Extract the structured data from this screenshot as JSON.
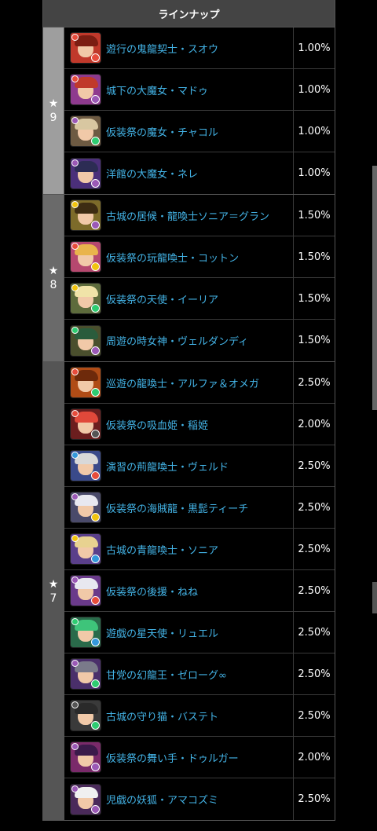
{
  "header": {
    "title": "ラインナップ"
  },
  "groups": [
    {
      "star": "★",
      "rank": "9",
      "items": [
        {
          "name": "遊行の鬼龍契士・スオウ",
          "rate": "1.00%",
          "bg": "#c0392b",
          "hair": "#7b1d12",
          "orb": "#e74c3c",
          "orb2": "#e74c3c"
        },
        {
          "name": "城下の大魔女・マドゥ",
          "rate": "1.00%",
          "bg": "#8e3a8e",
          "hair": "#c0392b",
          "orb": "#9b59b6",
          "orb2": "#e74c3c"
        },
        {
          "name": "仮装祭の魔女・チャコル",
          "rate": "1.00%",
          "bg": "#6d5a42",
          "hair": "#d8c7a1",
          "orb": "#2ecc71",
          "orb2": "#9b59b6"
        },
        {
          "name": "洋館の大魔女・ネレ",
          "rate": "1.00%",
          "bg": "#4b2f7a",
          "hair": "#2c2c54",
          "orb": "#9b59b6",
          "orb2": "#9b59b6"
        }
      ]
    },
    {
      "star": "★",
      "rank": "8",
      "items": [
        {
          "name": "古城の居候・龍喚士ソニア＝グラン",
          "rate": "1.50%",
          "bg": "#7d6b2a",
          "hair": "#3d2c12",
          "orb": "#9b59b6",
          "orb2": "#f1c40f"
        },
        {
          "name": "仮装祭の玩龍喚士・コットン",
          "rate": "1.50%",
          "bg": "#b6486f",
          "hair": "#e9b44c",
          "orb": "#f1c40f",
          "orb2": "#e74c3c"
        },
        {
          "name": "仮装祭の天使・イーリア",
          "rate": "1.50%",
          "bg": "#5d6b3c",
          "hair": "#f0e3a8",
          "orb": "#2ecc71",
          "orb2": "#f1c40f"
        },
        {
          "name": "周遊の時女神・ヴェルダンディ",
          "rate": "1.50%",
          "bg": "#4a4f2d",
          "hair": "#2a5c3c",
          "orb": "#9b59b6",
          "orb2": "#2ecc71"
        }
      ]
    },
    {
      "star": "★",
      "rank": "7",
      "items": [
        {
          "name": "巡遊の龍喚士・アルファ＆オメガ",
          "rate": "2.50%",
          "bg": "#b04c16",
          "hair": "#6e2a0b",
          "orb": "#2ecc71",
          "orb2": "#e74c3c"
        },
        {
          "name": "仮装祭の吸血姫・稲姫",
          "rate": "2.00%",
          "bg": "#6b1e1e",
          "hair": "#e0483a",
          "orb": "#555",
          "orb2": "#e74c3c"
        },
        {
          "name": "演習の荊龍喚士・ヴェルド",
          "rate": "2.50%",
          "bg": "#3a4a8a",
          "hair": "#d8d8d8",
          "orb": "#e74c3c",
          "orb2": "#3498db"
        },
        {
          "name": "仮装祭の海賊龍・黒髭ティーチ",
          "rate": "2.50%",
          "bg": "#4a4a6a",
          "hair": "#e8e8f0",
          "orb": "#f1c40f",
          "orb2": "#9b59b6"
        },
        {
          "name": "古城の青龍喚士・ソニア",
          "rate": "2.50%",
          "bg": "#5a3f8a",
          "hair": "#e8d290",
          "orb": "#3498db",
          "orb2": "#f1c40f"
        },
        {
          "name": "仮装祭の後援・ねね",
          "rate": "2.50%",
          "bg": "#6a3a8a",
          "hair": "#e8e8f0",
          "orb": "#e74c3c",
          "orb2": "#9b59b6"
        },
        {
          "name": "遊戯の星天使・リュエル",
          "rate": "2.50%",
          "bg": "#2a6a4a",
          "hair": "#3ec47a",
          "orb": "#3498db",
          "orb2": "#2ecc71"
        },
        {
          "name": "甘党の幻龍王・ゼローグ∞",
          "rate": "2.50%",
          "bg": "#4a2f6a",
          "hair": "#7a7a8a",
          "orb": "#2ecc71",
          "orb2": "#9b59b6"
        },
        {
          "name": "古城の守り猫・バステト",
          "rate": "2.50%",
          "bg": "#3a3a3a",
          "hair": "#2a2a2a",
          "orb": "#2ecc71",
          "orb2": "#555"
        },
        {
          "name": "仮装祭の舞い手・ドゥルガー",
          "rate": "2.00%",
          "bg": "#7a2a6a",
          "hair": "#3a1a4a",
          "orb": "#9b59b6",
          "orb2": "#9b59b6"
        },
        {
          "name": "児戯の妖狐・アマコズミ",
          "rate": "2.50%",
          "bg": "#4a2a5a",
          "hair": "#f0f0f0",
          "orb": "#9b59b6",
          "orb2": "#9b59b6"
        }
      ]
    }
  ]
}
